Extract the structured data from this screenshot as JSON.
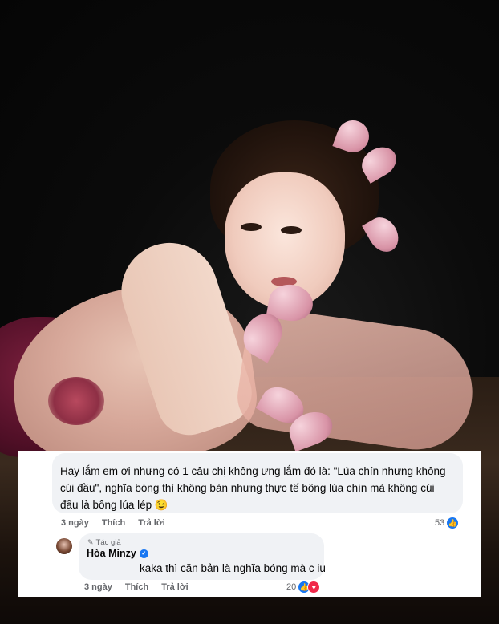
{
  "photo": {
    "description_icon": "photo-portrait"
  },
  "comments": [
    {
      "text": "Hay lắm em ơi nhưng có 1 câu chị không ưng lắm đó là: \"Lúa chín nhưng không cúi đầu\", nghĩa bóng thì không bàn nhưng thực tế bông lúa chín mà không cúi đầu là bông lúa lép 😉",
      "time": "3 ngày",
      "like_label": "Thích",
      "reply_label": "Trả lời",
      "reaction_count": "53",
      "reaction_icons": [
        "like-icon"
      ]
    }
  ],
  "reply": {
    "author_tag": "Tác giả",
    "author_name": "Hòa Minzy",
    "text": "kaka thì căn bản là nghĩa bóng mà c iu",
    "time": "3 ngày",
    "like_label": "Thích",
    "reply_label": "Trả lời",
    "reaction_count": "20",
    "reaction_icons": [
      "like-icon",
      "love-icon"
    ]
  },
  "colors": {
    "accent": "#1877f2",
    "love": "#f02849",
    "bubble": "#f0f2f5",
    "meta_text": "#65676b"
  }
}
